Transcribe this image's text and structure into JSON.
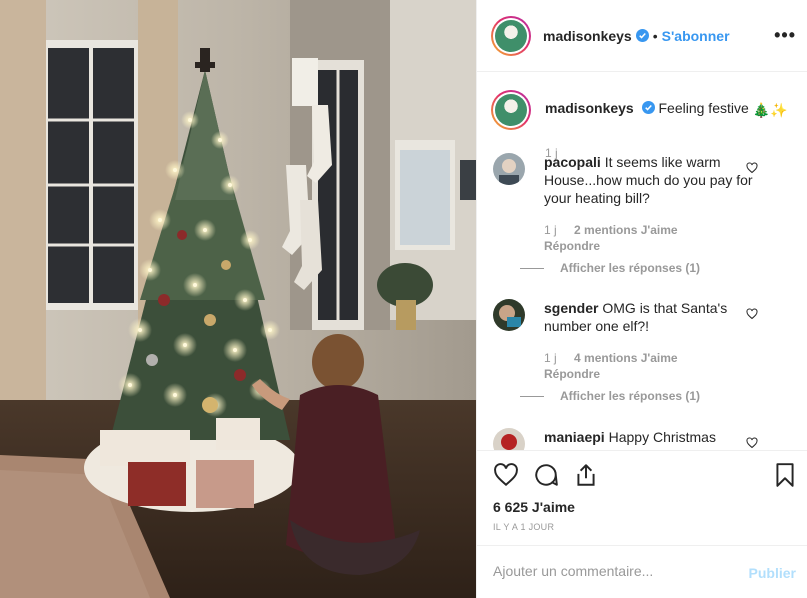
{
  "header": {
    "username": "madisonkeys",
    "separator": "•",
    "follow_label": "S'abonner",
    "more_label": "•••"
  },
  "caption": {
    "username": "madisonkeys",
    "text": "Feeling festive",
    "emoji": "🎄✨",
    "time": "1 j"
  },
  "comments": [
    {
      "username": "pacopali",
      "text": "It seems like warm House...how much do you pay for your heating bill?",
      "time": "1 j",
      "likes": "2 mentions J'aime",
      "reply_label": "Répondre",
      "view_replies": "Afficher les réponses (1)"
    },
    {
      "username": "sgender",
      "text": "OMG is that Santa's number one elf?!",
      "time": "1 j",
      "likes": "4 mentions J'aime",
      "reply_label": "Répondre",
      "view_replies": "Afficher les réponses (1)"
    },
    {
      "username": "maniaepi",
      "text": "Happy Christmas"
    }
  ],
  "actions": {
    "likes": "6 625 J'aime",
    "date": "IL Y A 1 JOUR",
    "icons": [
      "heart-icon",
      "comment-icon",
      "share-icon",
      "bookmark-icon"
    ]
  },
  "add_comment": {
    "placeholder": "Ajouter un commentaire...",
    "publish_label": "Publier"
  },
  "colors": {
    "link": "#3897f0",
    "muted": "#999999",
    "publish_disabled": "#b2dffc",
    "border": "#efefef"
  }
}
